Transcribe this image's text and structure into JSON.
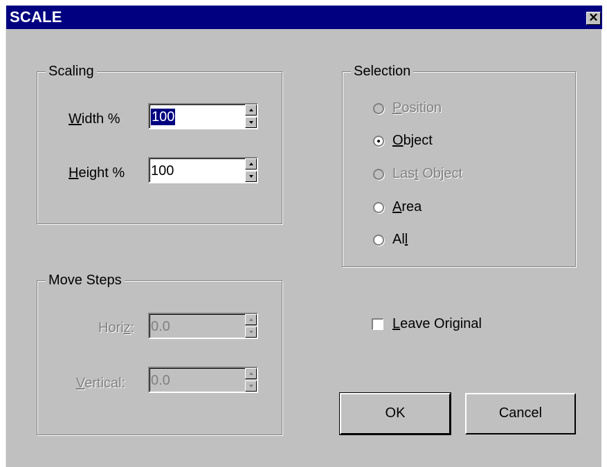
{
  "window": {
    "title": "SCALE",
    "close_glyph": "✕"
  },
  "scaling": {
    "legend": "Scaling",
    "width_label_u": "W",
    "width_label_rest": "idth %",
    "width_value": "100",
    "height_label_u": "H",
    "height_label_rest": "eight %",
    "height_value": "100"
  },
  "move_steps": {
    "legend": "Move Steps",
    "horiz_pre": "Hori",
    "horiz_u": "z",
    "horiz_post": ":",
    "horiz_value": "0.0",
    "vertical_u": "V",
    "vertical_rest": "ertical:",
    "vertical_value": "0.0"
  },
  "selection": {
    "legend": "Selection",
    "options": [
      {
        "u": "P",
        "rest": "osition",
        "enabled": false,
        "selected": false
      },
      {
        "u": "O",
        "rest": "bject",
        "enabled": true,
        "selected": true
      },
      {
        "pre": "Las",
        "u": "t",
        "rest": " Object",
        "enabled": false,
        "selected": false
      },
      {
        "u": "A",
        "rest": "rea",
        "enabled": true,
        "selected": false
      },
      {
        "pre": "Al",
        "u": "l",
        "rest": "",
        "enabled": true,
        "selected": false
      }
    ]
  },
  "leave_original": {
    "u": "L",
    "rest": "eave Original",
    "checked": false
  },
  "buttons": {
    "ok": "OK",
    "cancel": "Cancel"
  },
  "colors": {
    "face": "#c0c0c0",
    "titlebar": "#000080",
    "highlight": "#000080"
  }
}
